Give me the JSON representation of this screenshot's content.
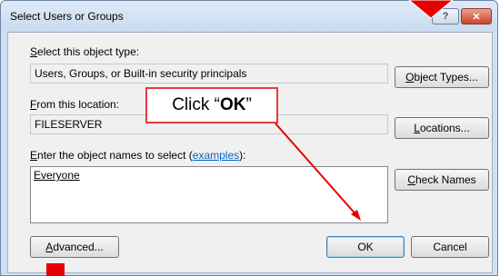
{
  "window": {
    "title": "Select Users or Groups",
    "help_glyph": "?",
    "close_glyph": "✕"
  },
  "object_type": {
    "label_prefix": "",
    "label_key": "S",
    "label_rest": "elect this object type:",
    "value": "Users, Groups, or Built-in security principals",
    "button_key": "O",
    "button_rest": "bject Types..."
  },
  "location": {
    "label_key": "F",
    "label_rest": "rom this location:",
    "value": "FILESERVER",
    "button_key": "L",
    "button_rest": "ocations..."
  },
  "names": {
    "label_key": "E",
    "label_rest": "nter the object names to select (",
    "label_link": "examples",
    "label_end": "):",
    "value": "Everyone",
    "check_key": "C",
    "check_rest": "heck Names"
  },
  "footer": {
    "advanced_key": "A",
    "advanced_rest": "dvanced...",
    "ok_label": "OK",
    "cancel_label": "Cancel"
  },
  "annotation": {
    "prefix": "Click “",
    "bold": "OK",
    "suffix": "”"
  },
  "colors": {
    "annotation_red": "#e60000",
    "callout_border": "#e8383d"
  }
}
